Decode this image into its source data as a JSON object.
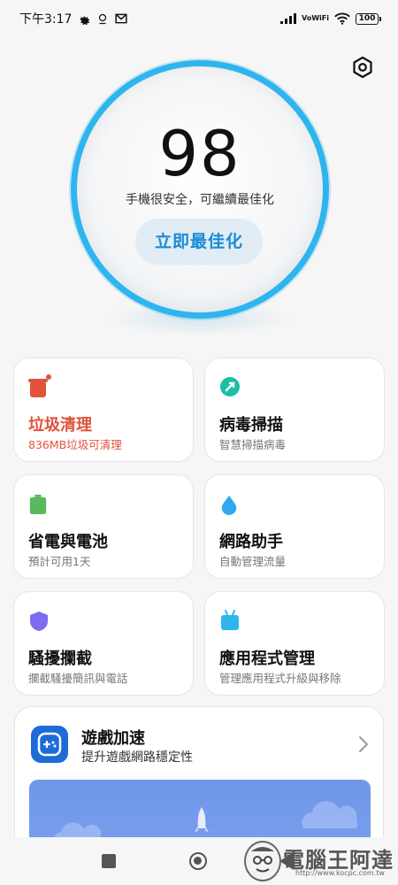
{
  "status_bar": {
    "time": "下午3:17",
    "volte_top": "Vo",
    "volte_bottom": "WiFi",
    "battery": "100"
  },
  "score": {
    "value": "98",
    "subtitle": "手機很安全，可繼續最佳化",
    "optimize_label": "立即最佳化"
  },
  "cards": [
    {
      "title": "垃圾清理",
      "subtitle": "836MB垃圾可清理",
      "icon": "trash-icon",
      "color": "#e0533a"
    },
    {
      "title": "病毒掃描",
      "subtitle": "智慧掃描病毒",
      "icon": "scan-icon",
      "color": "#1bc0a4"
    },
    {
      "title": "省電與電池",
      "subtitle": "預計可用1天",
      "icon": "battery-icon",
      "color": "#5cb85c"
    },
    {
      "title": "網路助手",
      "subtitle": "自動管理流量",
      "icon": "water-drop-icon",
      "color": "#2fa8ee"
    },
    {
      "title": "騷擾攔截",
      "subtitle": "攔截騷擾簡訊與電話",
      "icon": "shield-icon",
      "color": "#7b6cf0"
    },
    {
      "title": "應用程式管理",
      "subtitle": "管理應用程式升級與移除",
      "icon": "app-icon",
      "color": "#2fb5ee"
    }
  ],
  "game": {
    "title": "遊戲加速",
    "subtitle": "提升遊戲網路穩定性",
    "icon": "gamepad-icon"
  },
  "watermark": {
    "text": "電腦王阿達",
    "url": "http://www.kocpc.com.tw"
  },
  "colors": {
    "accent": "#2fb5ee",
    "junk": "#e0533a",
    "optimize_text": "#1a8bd6"
  }
}
